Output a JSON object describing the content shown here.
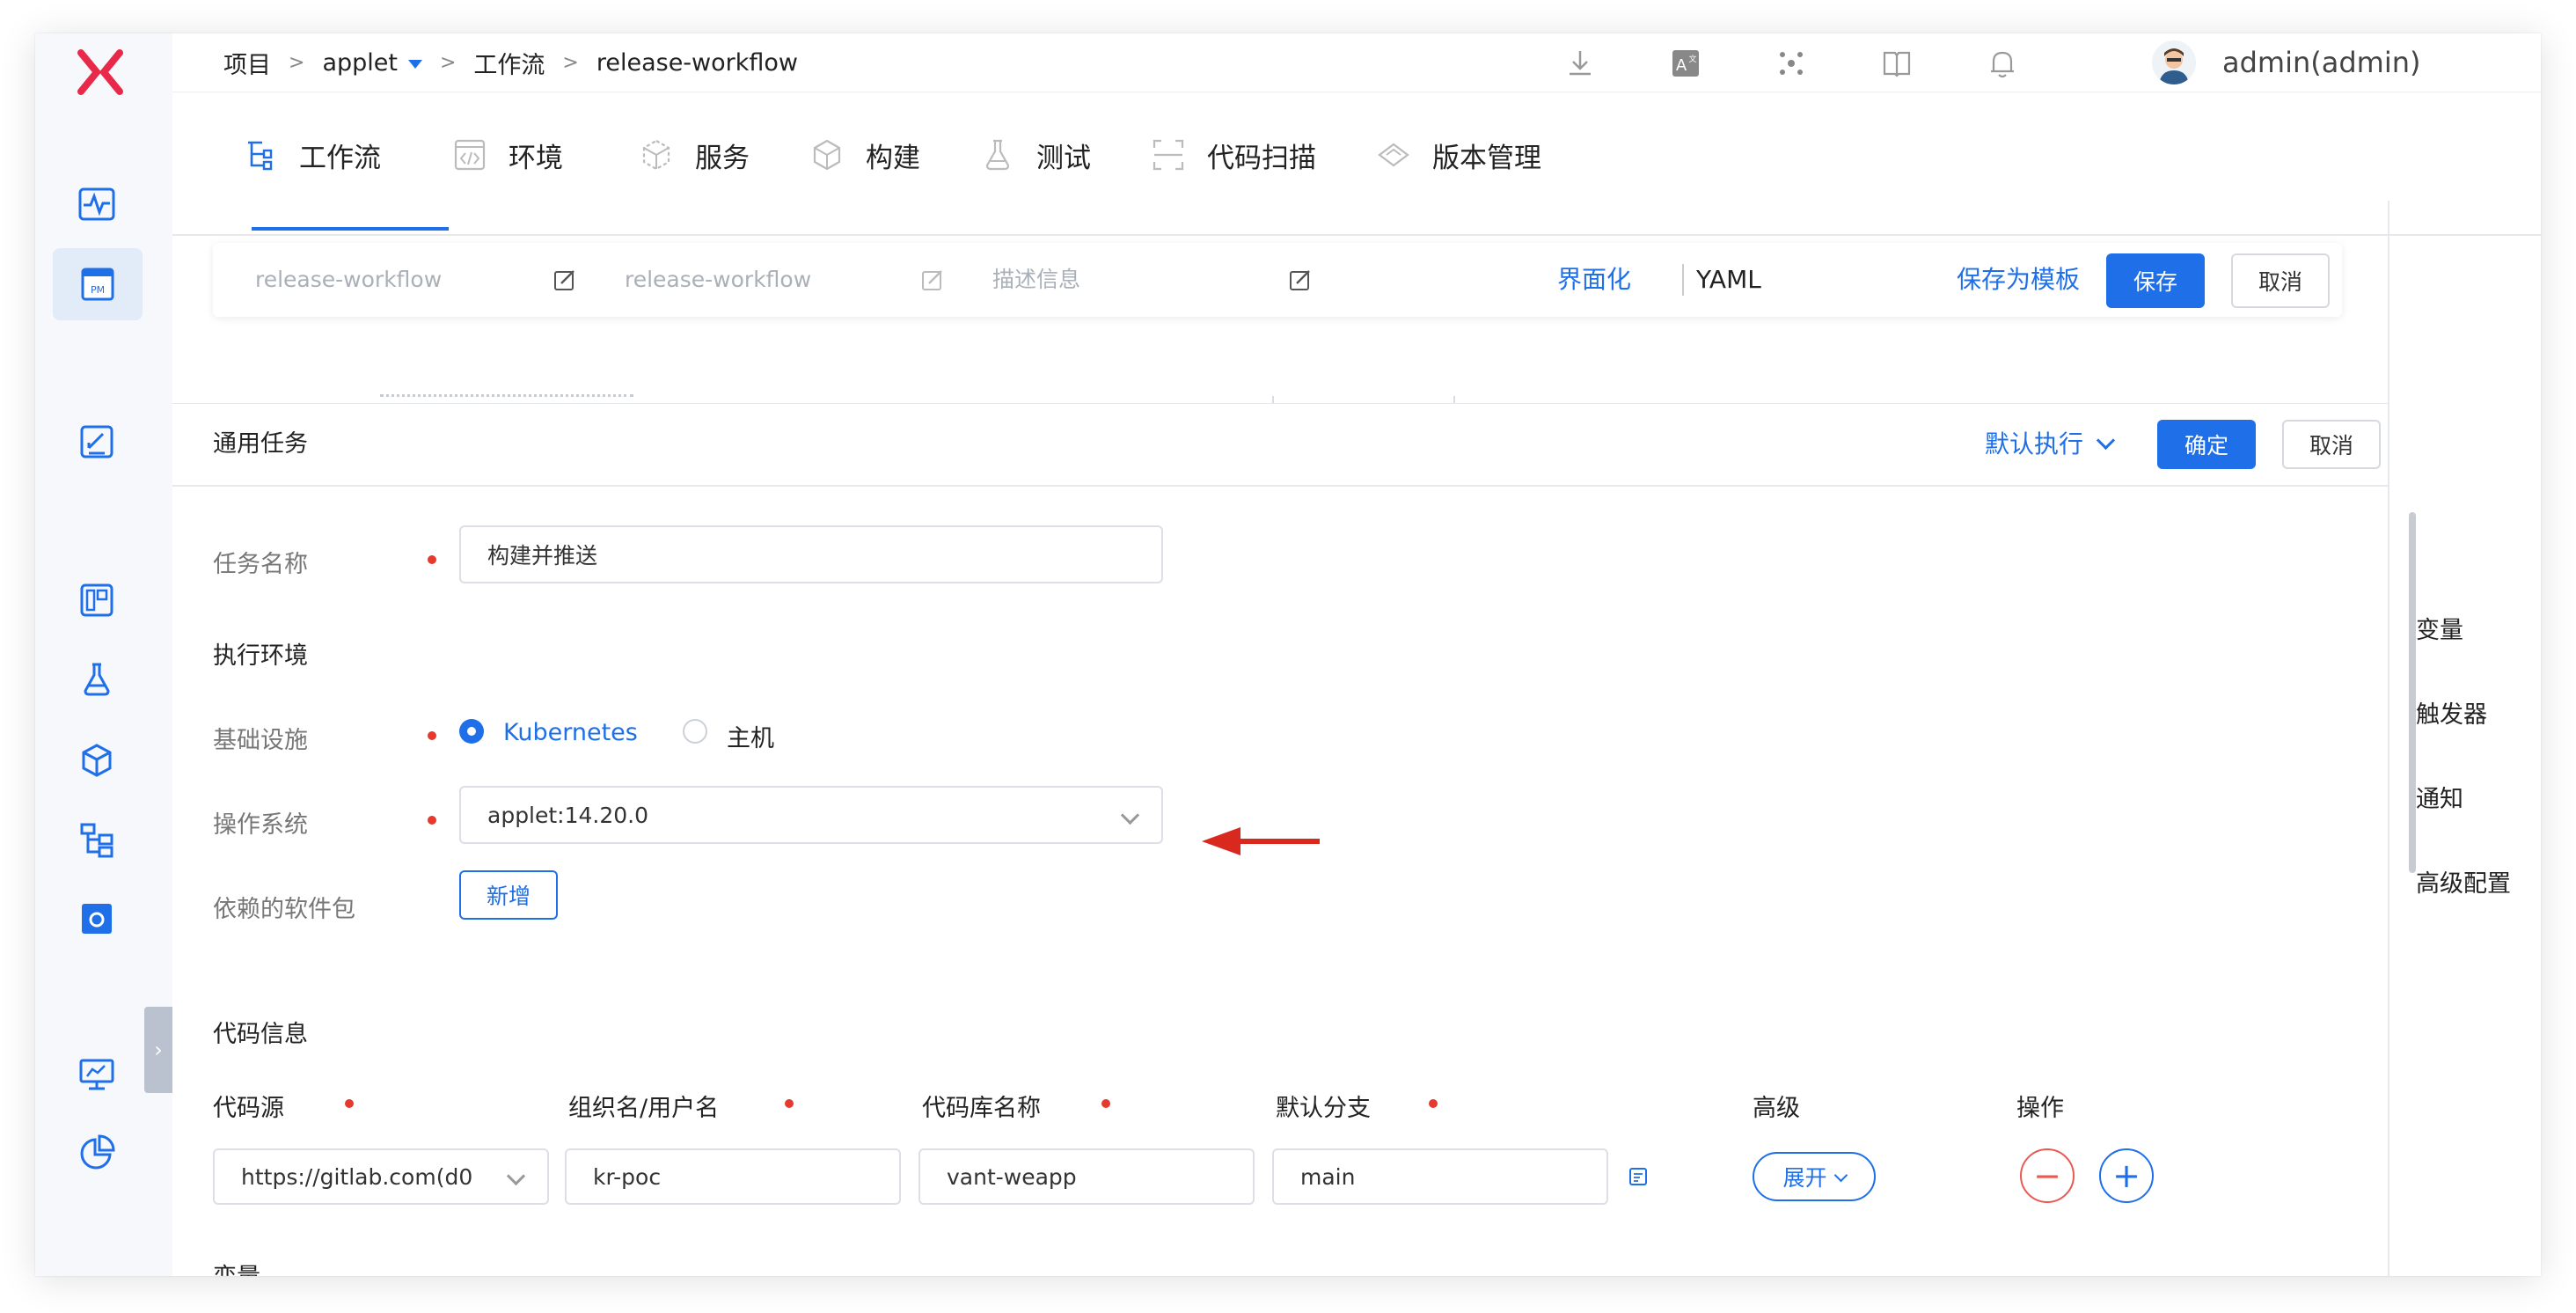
{
  "breadcrumb": {
    "project": "项目",
    "project_name": "applet",
    "workflow": "工作流",
    "workflow_name": "release-workflow"
  },
  "user": {
    "name": "admin(admin)"
  },
  "tabs": [
    {
      "label": "工作流",
      "icon": "workflow-icon"
    },
    {
      "label": "环境",
      "icon": "code-icon"
    },
    {
      "label": "服务",
      "icon": "cube-network-icon"
    },
    {
      "label": "构建",
      "icon": "box-icon"
    },
    {
      "label": "测试",
      "icon": "flask-icon"
    },
    {
      "label": "代码扫描",
      "icon": "scan-icon"
    },
    {
      "label": "版本管理",
      "icon": "diamond-icon"
    }
  ],
  "workflow_bar": {
    "name_placeholder": "release-workflow",
    "display_name_placeholder": "release-workflow",
    "description_placeholder": "描述信息",
    "mode_ui": "界面化",
    "mode_yaml": "YAML",
    "save_template": "保存为模板",
    "save": "保存",
    "cancel": "取消"
  },
  "side_nav": [
    "变量",
    "触发器",
    "通知",
    "高级配置"
  ],
  "task_panel": {
    "title": "通用任务",
    "exec_mode": "默认执行",
    "confirm": "确定",
    "cancel": "取消",
    "task_name_label": "任务名称",
    "task_name_value": "构建并推送",
    "exec_env_heading": "执行环境",
    "infra_label": "基础设施",
    "infra_options": [
      "Kubernetes",
      "主机"
    ],
    "os_label": "操作系统",
    "os_value": "applet:14.20.0",
    "deps_label": "依赖的软件包",
    "deps_add": "新增",
    "code_info_heading": "代码信息",
    "code_columns": [
      "代码源",
      "组织名/用户名",
      "代码库名称",
      "默认分支",
      "高级",
      "操作"
    ],
    "code_row": {
      "source": "https://gitlab.com(d0",
      "org": "kr-poc",
      "repo": "vant-weapp",
      "branch": "main",
      "advanced": "展开"
    },
    "variables_heading": "变量"
  },
  "colors": {
    "accent": "#1e6fe8",
    "required": "#e63a2e",
    "logo": "#e8294a"
  }
}
